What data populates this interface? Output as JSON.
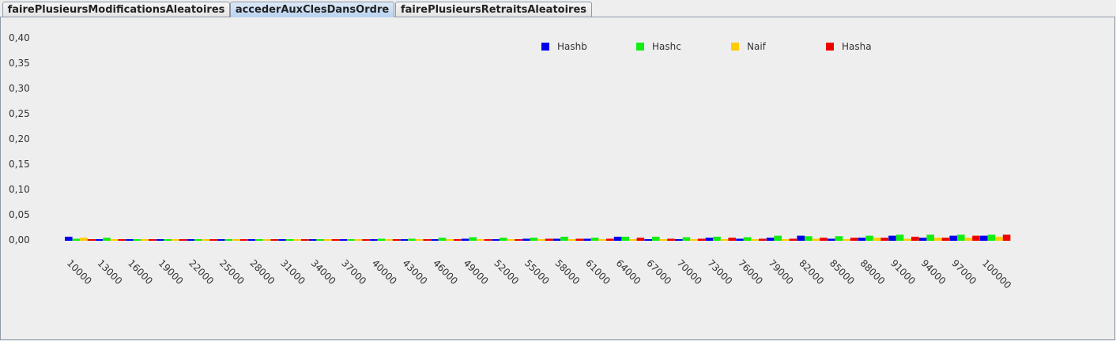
{
  "tabs": [
    {
      "label": "fairePlusieursModificationsAleatoires",
      "selected": false
    },
    {
      "label": "accederAuxClesDansOrdre",
      "selected": true
    },
    {
      "label": "fairePlusieursRetraitsAleatoires",
      "selected": false
    }
  ],
  "chart_data": {
    "type": "bar",
    "title": "",
    "xlabel": "",
    "ylabel": "",
    "ylim": [
      0,
      0.4
    ],
    "yticks": [
      "0,00",
      "0,05",
      "0,10",
      "0,15",
      "0,20",
      "0,25",
      "0,30",
      "0,35",
      "0,40"
    ],
    "legend_position": "top",
    "categories": [
      "10000",
      "13000",
      "16000",
      "19000",
      "22000",
      "25000",
      "28000",
      "31000",
      "34000",
      "37000",
      "40000",
      "43000",
      "46000",
      "49000",
      "52000",
      "55000",
      "58000",
      "61000",
      "64000",
      "67000",
      "70000",
      "73000",
      "76000",
      "79000",
      "82000",
      "85000",
      "88000",
      "91000",
      "94000",
      "97000",
      "100000"
    ],
    "series": [
      {
        "name": "Hashb",
        "color": "#0000ee",
        "values": [
          0.008,
          0.002,
          0.002,
          0.0,
          0.0,
          0.002,
          0.001,
          0.001,
          0.002,
          0.003,
          0.003,
          0.003,
          0.003,
          0.004,
          0.003,
          0.004,
          0.004,
          0.004,
          0.008,
          0.003,
          0.003,
          0.006,
          0.004,
          0.006,
          0.01,
          0.004,
          0.006,
          0.01,
          0.006,
          0.01,
          0.01
        ]
      },
      {
        "name": "Hashc",
        "color": "#11ee11",
        "values": [
          0.004,
          0.006,
          0.003,
          0.0,
          0.0,
          0.002,
          0.002,
          0.002,
          0.003,
          0.003,
          0.004,
          0.004,
          0.006,
          0.007,
          0.006,
          0.006,
          0.008,
          0.006,
          0.008,
          0.008,
          0.007,
          0.008,
          0.007,
          0.01,
          0.009,
          0.009,
          0.01,
          0.012,
          0.012,
          0.012,
          0.012
        ]
      },
      {
        "name": "Naif",
        "color": "#ffcc00",
        "values": [
          0.006,
          0.002,
          0.001,
          0.002,
          0.0,
          0.001,
          0.001,
          0.001,
          0.002,
          0.002,
          0.002,
          0.002,
          0.002,
          0.002,
          0.002,
          0.002,
          0.002,
          0.002,
          0.002,
          0.002,
          0.002,
          0.002,
          0.003,
          0.003,
          0.004,
          0.003,
          0.006,
          0.004,
          0.006,
          0.006,
          0.008
        ]
      },
      {
        "name": "Hasha",
        "color": "#ee0000",
        "values": [
          0.002,
          0.002,
          0.002,
          0.0,
          0.0,
          0.001,
          0.001,
          0.002,
          0.002,
          0.003,
          0.003,
          0.003,
          0.003,
          0.003,
          0.003,
          0.004,
          0.004,
          0.004,
          0.006,
          0.004,
          0.004,
          0.006,
          0.004,
          0.004,
          0.006,
          0.006,
          0.006,
          0.008,
          0.006,
          0.01,
          0.012
        ]
      }
    ]
  }
}
